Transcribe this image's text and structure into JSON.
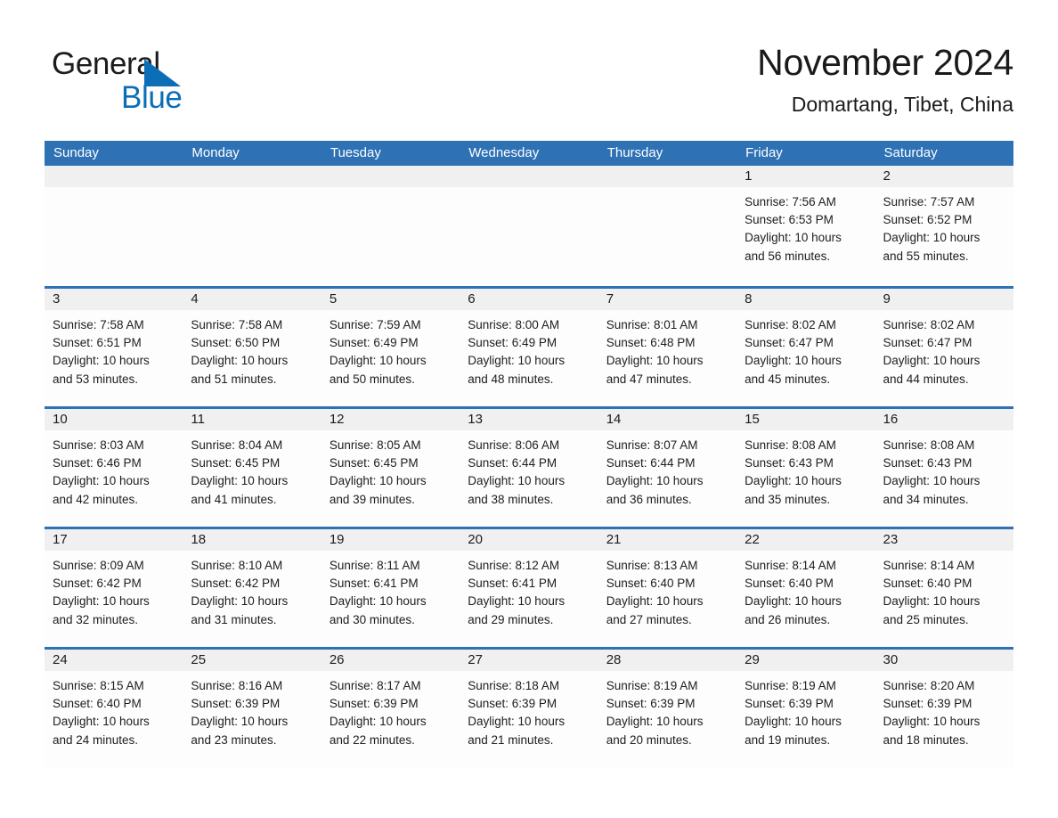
{
  "brand": {
    "name_part1": "General",
    "name_part2": "Blue",
    "accent_color": "#0d6eb8",
    "triangle_icon": "triangle-icon"
  },
  "header": {
    "title": "November 2024",
    "subtitle": "Domartang, Tibet, China"
  },
  "theme": {
    "header_blue": "#2e71b4",
    "daynum_band": "#f0f0f0",
    "cell_bg": "#fdfdfd",
    "text": "#1d1d1d"
  },
  "weekday_headers": [
    "Sunday",
    "Monday",
    "Tuesday",
    "Wednesday",
    "Thursday",
    "Friday",
    "Saturday"
  ],
  "weeks": [
    [
      {
        "day": "",
        "lines": []
      },
      {
        "day": "",
        "lines": []
      },
      {
        "day": "",
        "lines": []
      },
      {
        "day": "",
        "lines": []
      },
      {
        "day": "",
        "lines": []
      },
      {
        "day": "1",
        "lines": [
          "Sunrise: 7:56 AM",
          "Sunset: 6:53 PM",
          "Daylight: 10 hours",
          "and 56 minutes."
        ]
      },
      {
        "day": "2",
        "lines": [
          "Sunrise: 7:57 AM",
          "Sunset: 6:52 PM",
          "Daylight: 10 hours",
          "and 55 minutes."
        ]
      }
    ],
    [
      {
        "day": "3",
        "lines": [
          "Sunrise: 7:58 AM",
          "Sunset: 6:51 PM",
          "Daylight: 10 hours",
          "and 53 minutes."
        ]
      },
      {
        "day": "4",
        "lines": [
          "Sunrise: 7:58 AM",
          "Sunset: 6:50 PM",
          "Daylight: 10 hours",
          "and 51 minutes."
        ]
      },
      {
        "day": "5",
        "lines": [
          "Sunrise: 7:59 AM",
          "Sunset: 6:49 PM",
          "Daylight: 10 hours",
          "and 50 minutes."
        ]
      },
      {
        "day": "6",
        "lines": [
          "Sunrise: 8:00 AM",
          "Sunset: 6:49 PM",
          "Daylight: 10 hours",
          "and 48 minutes."
        ]
      },
      {
        "day": "7",
        "lines": [
          "Sunrise: 8:01 AM",
          "Sunset: 6:48 PM",
          "Daylight: 10 hours",
          "and 47 minutes."
        ]
      },
      {
        "day": "8",
        "lines": [
          "Sunrise: 8:02 AM",
          "Sunset: 6:47 PM",
          "Daylight: 10 hours",
          "and 45 minutes."
        ]
      },
      {
        "day": "9",
        "lines": [
          "Sunrise: 8:02 AM",
          "Sunset: 6:47 PM",
          "Daylight: 10 hours",
          "and 44 minutes."
        ]
      }
    ],
    [
      {
        "day": "10",
        "lines": [
          "Sunrise: 8:03 AM",
          "Sunset: 6:46 PM",
          "Daylight: 10 hours",
          "and 42 minutes."
        ]
      },
      {
        "day": "11",
        "lines": [
          "Sunrise: 8:04 AM",
          "Sunset: 6:45 PM",
          "Daylight: 10 hours",
          "and 41 minutes."
        ]
      },
      {
        "day": "12",
        "lines": [
          "Sunrise: 8:05 AM",
          "Sunset: 6:45 PM",
          "Daylight: 10 hours",
          "and 39 minutes."
        ]
      },
      {
        "day": "13",
        "lines": [
          "Sunrise: 8:06 AM",
          "Sunset: 6:44 PM",
          "Daylight: 10 hours",
          "and 38 minutes."
        ]
      },
      {
        "day": "14",
        "lines": [
          "Sunrise: 8:07 AM",
          "Sunset: 6:44 PM",
          "Daylight: 10 hours",
          "and 36 minutes."
        ]
      },
      {
        "day": "15",
        "lines": [
          "Sunrise: 8:08 AM",
          "Sunset: 6:43 PM",
          "Daylight: 10 hours",
          "and 35 minutes."
        ]
      },
      {
        "day": "16",
        "lines": [
          "Sunrise: 8:08 AM",
          "Sunset: 6:43 PM",
          "Daylight: 10 hours",
          "and 34 minutes."
        ]
      }
    ],
    [
      {
        "day": "17",
        "lines": [
          "Sunrise: 8:09 AM",
          "Sunset: 6:42 PM",
          "Daylight: 10 hours",
          "and 32 minutes."
        ]
      },
      {
        "day": "18",
        "lines": [
          "Sunrise: 8:10 AM",
          "Sunset: 6:42 PM",
          "Daylight: 10 hours",
          "and 31 minutes."
        ]
      },
      {
        "day": "19",
        "lines": [
          "Sunrise: 8:11 AM",
          "Sunset: 6:41 PM",
          "Daylight: 10 hours",
          "and 30 minutes."
        ]
      },
      {
        "day": "20",
        "lines": [
          "Sunrise: 8:12 AM",
          "Sunset: 6:41 PM",
          "Daylight: 10 hours",
          "and 29 minutes."
        ]
      },
      {
        "day": "21",
        "lines": [
          "Sunrise: 8:13 AM",
          "Sunset: 6:40 PM",
          "Daylight: 10 hours",
          "and 27 minutes."
        ]
      },
      {
        "day": "22",
        "lines": [
          "Sunrise: 8:14 AM",
          "Sunset: 6:40 PM",
          "Daylight: 10 hours",
          "and 26 minutes."
        ]
      },
      {
        "day": "23",
        "lines": [
          "Sunrise: 8:14 AM",
          "Sunset: 6:40 PM",
          "Daylight: 10 hours",
          "and 25 minutes."
        ]
      }
    ],
    [
      {
        "day": "24",
        "lines": [
          "Sunrise: 8:15 AM",
          "Sunset: 6:40 PM",
          "Daylight: 10 hours",
          "and 24 minutes."
        ]
      },
      {
        "day": "25",
        "lines": [
          "Sunrise: 8:16 AM",
          "Sunset: 6:39 PM",
          "Daylight: 10 hours",
          "and 23 minutes."
        ]
      },
      {
        "day": "26",
        "lines": [
          "Sunrise: 8:17 AM",
          "Sunset: 6:39 PM",
          "Daylight: 10 hours",
          "and 22 minutes."
        ]
      },
      {
        "day": "27",
        "lines": [
          "Sunrise: 8:18 AM",
          "Sunset: 6:39 PM",
          "Daylight: 10 hours",
          "and 21 minutes."
        ]
      },
      {
        "day": "28",
        "lines": [
          "Sunrise: 8:19 AM",
          "Sunset: 6:39 PM",
          "Daylight: 10 hours",
          "and 20 minutes."
        ]
      },
      {
        "day": "29",
        "lines": [
          "Sunrise: 8:19 AM",
          "Sunset: 6:39 PM",
          "Daylight: 10 hours",
          "and 19 minutes."
        ]
      },
      {
        "day": "30",
        "lines": [
          "Sunrise: 8:20 AM",
          "Sunset: 6:39 PM",
          "Daylight: 10 hours",
          "and 18 minutes."
        ]
      }
    ]
  ]
}
